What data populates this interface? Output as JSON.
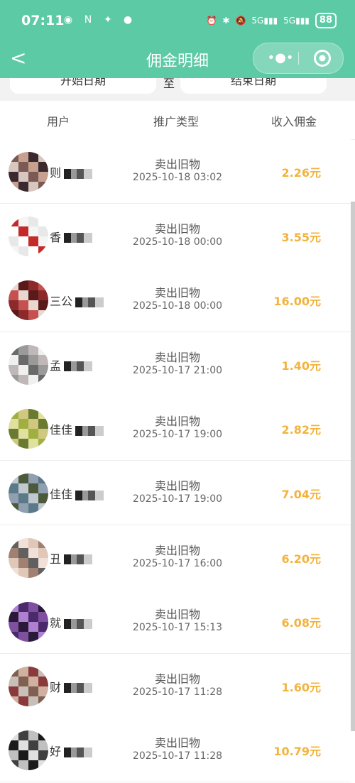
{
  "status": {
    "time": "07:11",
    "net1": "5G",
    "net2": "5G",
    "battery": "88"
  },
  "nav": {
    "title": "佣金明细"
  },
  "dates": {
    "start": "开始日期",
    "separator": "至",
    "end": "结束日期"
  },
  "columns": {
    "user": "用户",
    "type": "推广类型",
    "income": "收入佣金"
  },
  "rows": [
    {
      "name": "则",
      "type": "卖出旧物",
      "time": "2025-10-18 03:02",
      "amount": "2.26元"
    },
    {
      "name": "香",
      "type": "卖出旧物",
      "time": "2025-10-18 00:00",
      "amount": "3.55元"
    },
    {
      "name": "三公",
      "type": "卖出旧物",
      "time": "2025-10-18 00:00",
      "amount": "16.00元"
    },
    {
      "name": "孟",
      "type": "卖出旧物",
      "time": "2025-10-17 21:00",
      "amount": "1.40元"
    },
    {
      "name": "佳佳",
      "type": "卖出旧物",
      "time": "2025-10-17 19:00",
      "amount": "2.82元"
    },
    {
      "name": "佳佳",
      "type": "卖出旧物",
      "time": "2025-10-17 19:00",
      "amount": "7.04元"
    },
    {
      "name": "丑",
      "type": "卖出旧物",
      "time": "2025-10-17 16:00",
      "amount": "6.20元"
    },
    {
      "name": "就",
      "type": "卖出旧物",
      "time": "2025-10-17 15:13",
      "amount": "6.08元"
    },
    {
      "name": "财",
      "type": "卖出旧物",
      "time": "2025-10-17 11:28",
      "amount": "1.60元"
    },
    {
      "name": "好",
      "type": "卖出旧物",
      "time": "2025-10-17 11:28",
      "amount": "10.79元"
    }
  ],
  "colors": {
    "header": "#5ccaa4",
    "amount": "#f3b33d"
  }
}
